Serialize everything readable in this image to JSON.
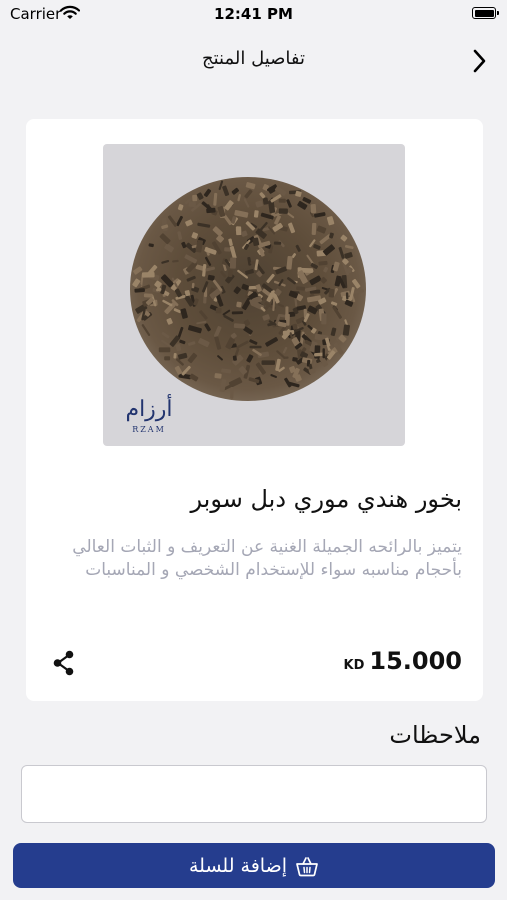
{
  "status_bar": {
    "carrier": "Carrier",
    "time": "12:41 PM"
  },
  "header": {
    "title": "تفاصيل المنتج"
  },
  "product": {
    "image_brand_arabic": "أرزام",
    "image_brand_latin": "RZAM",
    "name": "بخور هندي موري دبل سوبر",
    "description": "يتميز بالرائحه الجميلة الغنية عن التعريف و الثبات العالي بأحجام مناسبه سواء للإستخدام الشخصي و المناسبات",
    "price": "15.000",
    "currency": "KD"
  },
  "notes": {
    "label": "ملاحظات",
    "value": ""
  },
  "cart": {
    "button_label": "إضافة للسلة"
  },
  "colors": {
    "primary": "#253d8e",
    "background": "#f2f2f4",
    "description_text": "#a5a7b5"
  },
  "icons": [
    "wifi-icon",
    "battery-icon",
    "chevron-right-icon",
    "share-icon",
    "basket-icon"
  ]
}
